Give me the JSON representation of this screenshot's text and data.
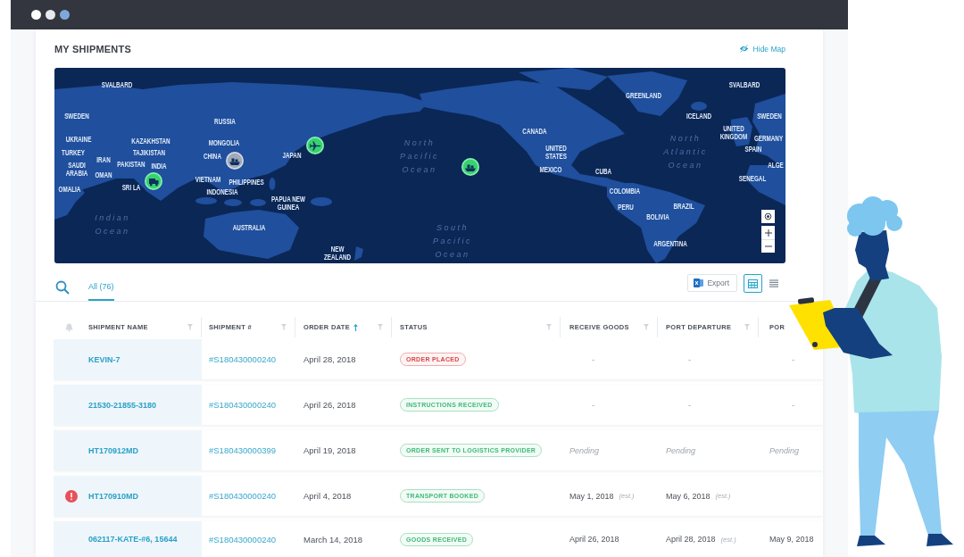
{
  "header": {
    "title": "MY SHIPMENTS",
    "hide_map": "Hide Map"
  },
  "map": {
    "labels": [
      {
        "kind": "country",
        "lines": [
          "SVALBARD"
        ]
      },
      {
        "kind": "country",
        "lines": [
          "SVALBARD"
        ]
      },
      {
        "kind": "country",
        "lines": [
          "GREENLAND"
        ]
      },
      {
        "kind": "country",
        "lines": [
          "SWEDEN"
        ]
      },
      {
        "kind": "country",
        "lines": [
          "RUSSIA"
        ]
      },
      {
        "kind": "country",
        "lines": [
          "ICELAND"
        ]
      },
      {
        "kind": "country",
        "lines": [
          "SWEDEN"
        ]
      },
      {
        "kind": "country",
        "lines": [
          "UKRAINE"
        ]
      },
      {
        "kind": "country",
        "lines": [
          "KAZAKHSTAN"
        ]
      },
      {
        "kind": "country",
        "lines": [
          "MONGOLIA"
        ]
      },
      {
        "kind": "country",
        "lines": [
          "CANADA"
        ]
      },
      {
        "kind": "country",
        "lines": [
          "UNITED",
          "KINGDOM"
        ]
      },
      {
        "kind": "country",
        "lines": [
          "GERMANY"
        ]
      },
      {
        "kind": "country",
        "lines": [
          "TURKEY"
        ]
      },
      {
        "kind": "country",
        "lines": [
          "TAJIKISTAN"
        ]
      },
      {
        "kind": "country",
        "lines": [
          "CHINA"
        ]
      },
      {
        "kind": "country",
        "lines": [
          "JAPAN"
        ]
      },
      {
        "kind": "ocean",
        "lines": [
          "North",
          "Pacific",
          "Ocean"
        ]
      },
      {
        "kind": "country",
        "lines": [
          "UNITED",
          "STATES"
        ]
      },
      {
        "kind": "ocean",
        "lines": [
          "North",
          "Atlantic",
          "Ocean"
        ]
      },
      {
        "kind": "country",
        "lines": [
          "SPAIN"
        ]
      },
      {
        "kind": "country",
        "lines": [
          "SAUDI",
          "ARABIA"
        ]
      },
      {
        "kind": "country",
        "lines": [
          "IRAN"
        ]
      },
      {
        "kind": "country",
        "lines": [
          "OMAN"
        ]
      },
      {
        "kind": "country",
        "lines": [
          "PAKISTAN"
        ]
      },
      {
        "kind": "country",
        "lines": [
          "INDIA"
        ]
      },
      {
        "kind": "country",
        "lines": [
          "MEXICO"
        ]
      },
      {
        "kind": "country",
        "lines": [
          "CUBA"
        ]
      },
      {
        "kind": "country",
        "lines": [
          "ALGE"
        ]
      },
      {
        "kind": "country",
        "lines": [
          "OMALIA"
        ]
      },
      {
        "kind": "country",
        "lines": [
          "SRI LA"
        ]
      },
      {
        "kind": "country",
        "lines": [
          "VIETNAM"
        ]
      },
      {
        "kind": "country",
        "lines": [
          "PHILIPPINES"
        ]
      },
      {
        "kind": "country",
        "lines": [
          "COLOMBIA"
        ]
      },
      {
        "kind": "country",
        "lines": [
          "SENEGAL"
        ]
      },
      {
        "kind": "country",
        "lines": [
          "INDONESIA"
        ]
      },
      {
        "kind": "country",
        "lines": [
          "PAPUA NEW",
          "GUINEA"
        ]
      },
      {
        "kind": "country",
        "lines": [
          "PERU"
        ]
      },
      {
        "kind": "country",
        "lines": [
          "BOLIVIA"
        ]
      },
      {
        "kind": "country",
        "lines": [
          "BRAZIL"
        ]
      },
      {
        "kind": "ocean",
        "lines": [
          "Indian",
          "Ocean"
        ]
      },
      {
        "kind": "country",
        "lines": [
          "AUSTRALIA"
        ]
      },
      {
        "kind": "country",
        "lines": [
          "NEW",
          "ZEALAND"
        ]
      },
      {
        "kind": "ocean",
        "lines": [
          "South",
          "Pacific",
          "Ocean"
        ]
      },
      {
        "kind": "country",
        "lines": [
          "ARGENTINA"
        ]
      }
    ],
    "markers": [
      {
        "kind": "truck",
        "active": true
      },
      {
        "kind": "ship",
        "active": false
      },
      {
        "kind": "plane",
        "active": true
      },
      {
        "kind": "ship",
        "active": true
      }
    ]
  },
  "toolbar": {
    "tabs": [
      {
        "label": "All (76)",
        "selected": true
      }
    ],
    "export": "Export",
    "views": [
      {
        "kind": "table",
        "selected": true
      },
      {
        "kind": "list",
        "selected": false
      }
    ]
  },
  "table": {
    "columns": [
      {
        "label": "SHIPMENT NAME",
        "filter": true,
        "sorted": false
      },
      {
        "label": "SHIPMENT #",
        "filter": true,
        "sorted": false
      },
      {
        "label": "ORDER DATE",
        "filter": true,
        "sorted": true
      },
      {
        "label": "STATUS",
        "filter": true,
        "sorted": false
      },
      {
        "label": "RECEIVE GOODS",
        "filter": true,
        "sorted": false
      },
      {
        "label": "PORT DEPARTURE",
        "filter": true,
        "sorted": false
      },
      {
        "label": "POR",
        "filter": false,
        "sorted": false
      }
    ],
    "rows": [
      {
        "name": "KEVIN-7",
        "alert": false,
        "shipment": "#S180430000240",
        "order_date": "April 28, 2018",
        "status": {
          "label": "ORDER PLACED",
          "color": "#dc4646"
        },
        "milestones": [
          {
            "kind": "empty",
            "text": "-"
          },
          {
            "kind": "empty",
            "text": "-"
          },
          {
            "kind": "empty",
            "text": "-"
          }
        ]
      },
      {
        "name": "21530-21855-3180",
        "alert": false,
        "shipment": "#S180430000240",
        "order_date": "April 26, 2018",
        "status": {
          "label": "INSTRUCTIONS RECEIVED",
          "color": "#3dba76"
        },
        "milestones": [
          {
            "kind": "empty",
            "text": "-"
          },
          {
            "kind": "empty",
            "text": "-"
          },
          {
            "kind": "empty",
            "text": "-"
          }
        ]
      },
      {
        "name": "HT170912MD",
        "alert": false,
        "shipment": "#S180430000399",
        "order_date": "April 19, 2018",
        "status": {
          "label": "ORDER SENT TO LOGISTICS PROVIDER",
          "color": "#3dba76"
        },
        "milestones": [
          {
            "kind": "pending",
            "text": "Pending"
          },
          {
            "kind": "pending",
            "text": "Pending"
          },
          {
            "kind": "pending",
            "text": "Pending"
          }
        ]
      },
      {
        "name": "HT170910MD",
        "alert": true,
        "shipment": "#S180430000240",
        "order_date": "April 4, 2018",
        "status": {
          "label": "TRANSPORT BOOKED",
          "color": "#3dba76"
        },
        "milestones": [
          {
            "kind": "date",
            "text": "May 1, 2018",
            "note": "(est.)"
          },
          {
            "kind": "date",
            "text": "May 6, 2018",
            "note": "(est.)"
          }
        ]
      },
      {
        "name": "062117-KATE-#6, 15644",
        "alert": false,
        "shipment": "#S180430000240",
        "order_date": "March 14, 2018",
        "status": {
          "label": "GOODS RECEIVED",
          "color": "#3dba76"
        },
        "milestones": [
          {
            "kind": "date",
            "text": "April 26, 2018"
          },
          {
            "kind": "date",
            "text": "April 28, 2018",
            "note": "(est.)"
          },
          {
            "kind": "date",
            "text": "May 9, 2018"
          }
        ]
      }
    ]
  }
}
